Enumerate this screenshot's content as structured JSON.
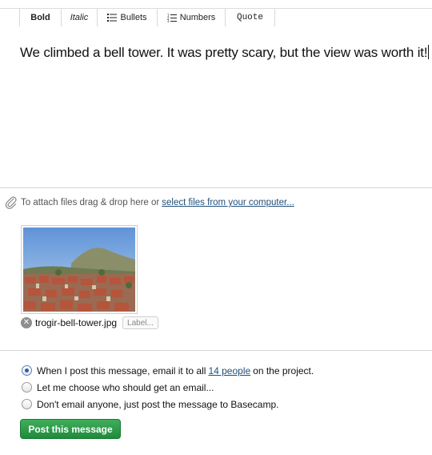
{
  "toolbar": {
    "bold": "Bold",
    "italic": "Italic",
    "bullets": "Bullets",
    "numbers": "Numbers",
    "quote": "Quote"
  },
  "editor": {
    "text": "We climbed a bell tower. It was pretty scary, but the view was worth it!"
  },
  "attach": {
    "prefix": "To attach files drag & drop here or",
    "link": "select files from your computer..."
  },
  "file": {
    "name": "trogir-bell-tower.jpg",
    "label_placeholder": "Label..."
  },
  "notify": {
    "option1_prefix": "When I post this message, email it to all",
    "option1_link": "14 people",
    "option1_suffix": "on the project.",
    "option2": "Let me choose who should get an email...",
    "option3": "Don't email anyone, just post the message to Basecamp.",
    "selected": 1
  },
  "actions": {
    "post": "Post this message"
  },
  "colors": {
    "post_button": "#2a9a48",
    "link": "#1f4e79",
    "radio_selected": "#2a5db0"
  }
}
